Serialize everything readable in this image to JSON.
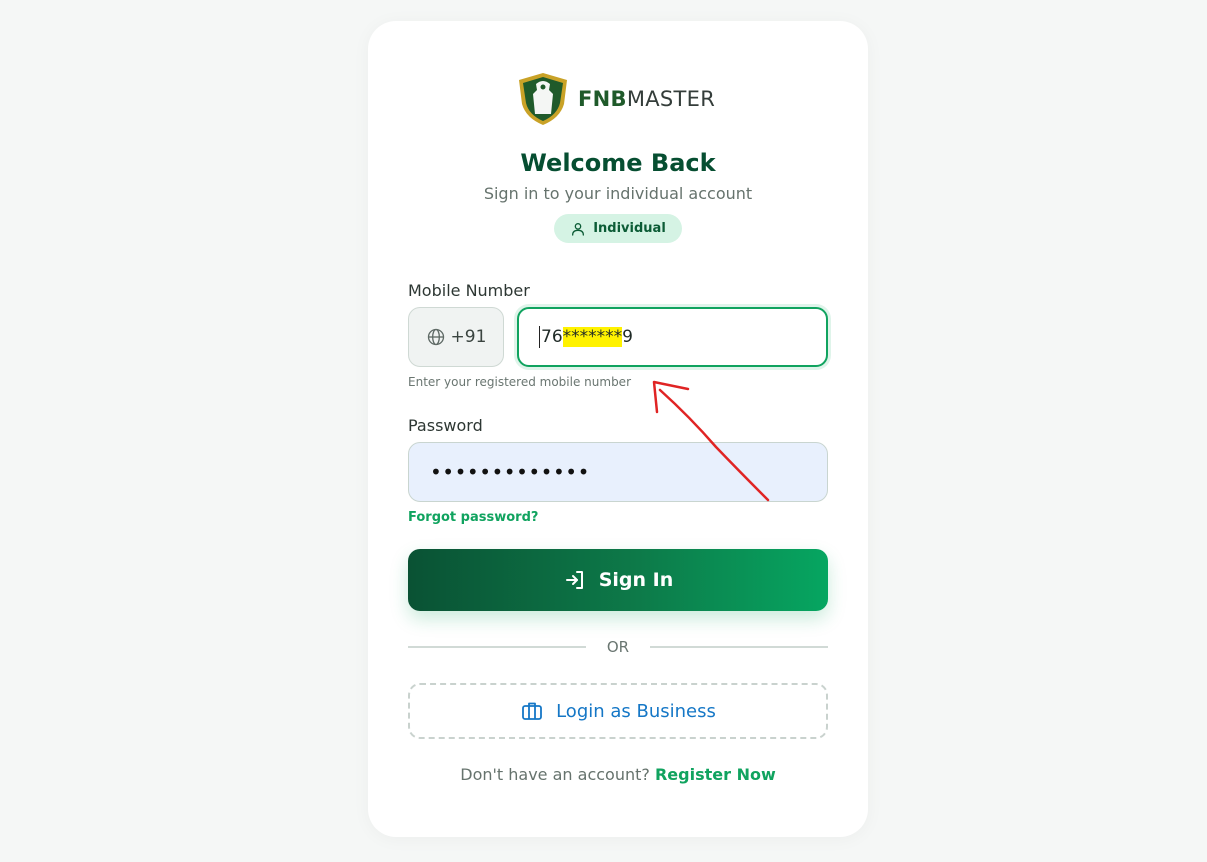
{
  "brand": {
    "name_part1": "FNB",
    "name_part2": "MASTER",
    "shield_color": "#1f5a2a",
    "accent_color": "#10a35f"
  },
  "header": {
    "title": "Welcome Back",
    "subtitle": "Sign in to your individual account",
    "badge_label": "Individual",
    "badge_icon": "user-icon"
  },
  "form": {
    "mobile": {
      "label": "Mobile Number",
      "country_code": "+91",
      "country_icon": "globe-icon",
      "value_prefix": "76",
      "value_masked": "*******",
      "value_suffix": "9",
      "helper": "Enter your registered mobile number"
    },
    "password": {
      "label": "Password",
      "value": "•••••••••••••"
    },
    "forgot_label": "Forgot password?",
    "signin_label": "Sign In",
    "signin_icon": "login-arrow-icon"
  },
  "divider": {
    "or_text": "OR"
  },
  "business": {
    "label": "Login as Business",
    "icon": "briefcase-icon"
  },
  "footer": {
    "prompt": "Don't have an account?",
    "register_label": "Register Now"
  },
  "annotation": {
    "type": "red-arrow",
    "color": "#e02424"
  }
}
